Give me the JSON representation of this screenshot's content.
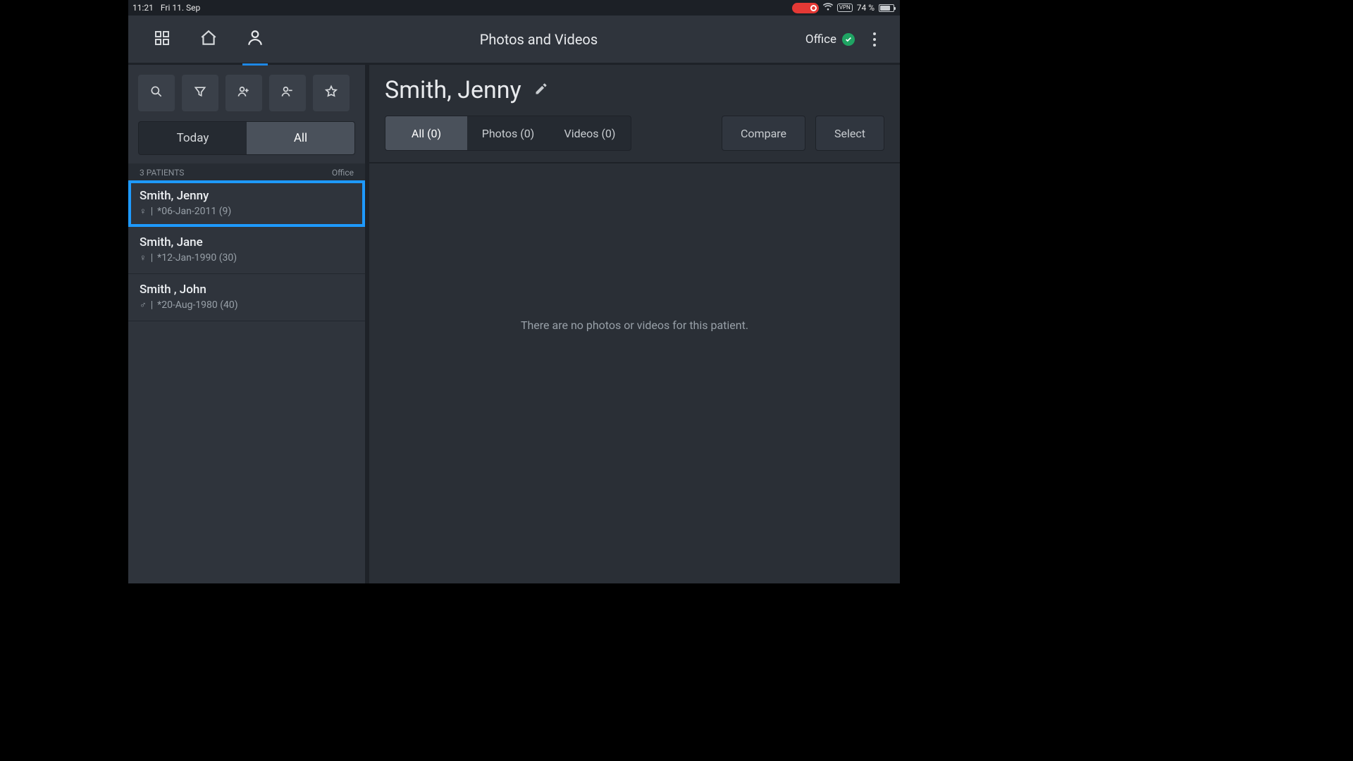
{
  "statusbar": {
    "time": "11:21",
    "date": "Fri 11. Sep",
    "vpn": "VPN",
    "battery_pct": "74 %"
  },
  "topbar": {
    "title": "Photos and Videos",
    "office_label": "Office"
  },
  "sidebar": {
    "seg_today": "Today",
    "seg_all": "All",
    "count_label": "3 PATIENTS",
    "location_label": "Office",
    "patients": [
      {
        "name": "Smith, Jenny",
        "gender": "♀",
        "meta": "*06-Jan-2011 (9)",
        "selected": true
      },
      {
        "name": "Smith, Jane",
        "gender": "♀",
        "meta": "*12-Jan-1990 (30)",
        "selected": false
      },
      {
        "name": "Smith , John",
        "gender": "♂",
        "meta": "*20-Aug-1980 (40)",
        "selected": false
      }
    ]
  },
  "main": {
    "patient_name": "Smith, Jenny",
    "tabs": {
      "all": "All (0)",
      "photos": "Photos (0)",
      "videos": "Videos (0)"
    },
    "compare": "Compare",
    "select": "Select",
    "empty": "There are no photos or videos for this patient."
  }
}
